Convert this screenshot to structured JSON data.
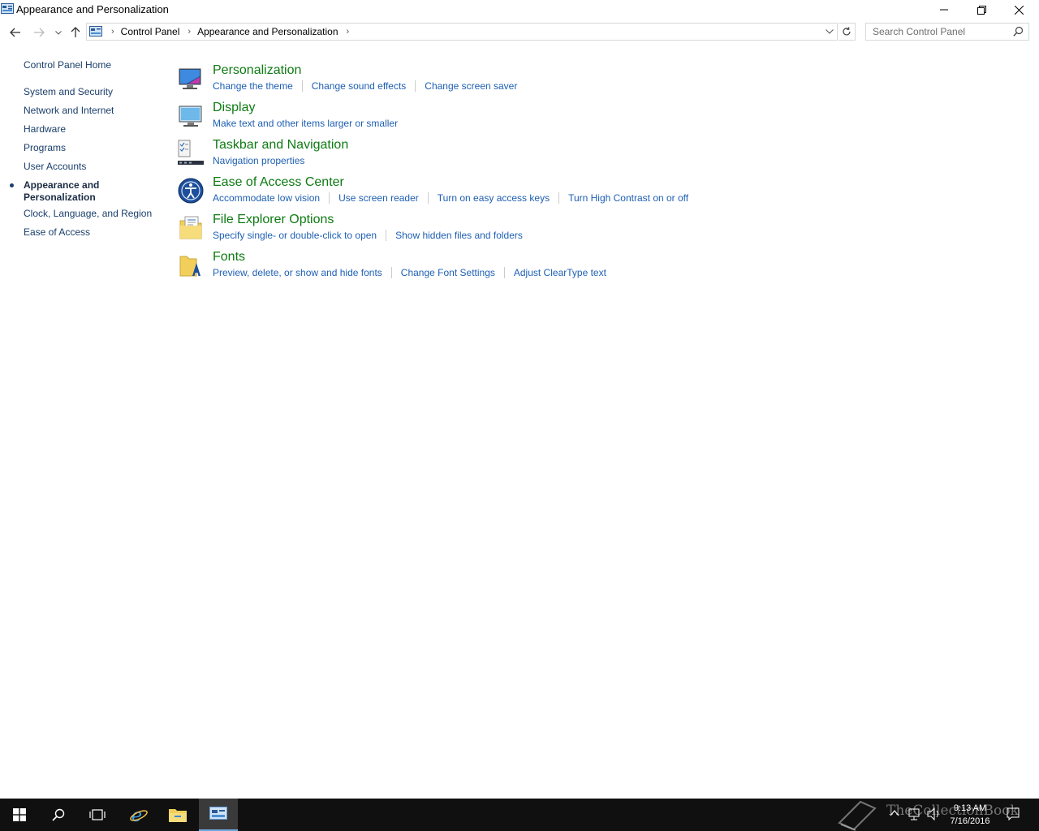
{
  "window": {
    "title": "Appearance and Personalization"
  },
  "address": {
    "crumbs": [
      "Control Panel",
      "Appearance and Personalization"
    ],
    "search_placeholder": "Search Control Panel"
  },
  "sidebar": {
    "home": "Control Panel Home",
    "items": [
      "System and Security",
      "Network and Internet",
      "Hardware",
      "Programs",
      "User Accounts"
    ],
    "active": "Appearance and Personalization",
    "items_after": [
      "Clock, Language, and Region",
      "Ease of Access"
    ]
  },
  "categories": [
    {
      "title": "Personalization",
      "icon": "personalization-icon",
      "links": [
        "Change the theme",
        "Change sound effects",
        "Change screen saver"
      ]
    },
    {
      "title": "Display",
      "icon": "display-icon",
      "links": [
        "Make text and other items larger or smaller"
      ]
    },
    {
      "title": "Taskbar and Navigation",
      "icon": "taskbar-icon",
      "links": [
        "Navigation properties"
      ]
    },
    {
      "title": "Ease of Access Center",
      "icon": "ease-of-access-icon",
      "links": [
        "Accommodate low vision",
        "Use screen reader",
        "Turn on easy access keys",
        "Turn High Contrast on or off"
      ]
    },
    {
      "title": "File Explorer Options",
      "icon": "folder-options-icon",
      "links": [
        "Specify single- or double-click to open",
        "Show hidden files and folders"
      ]
    },
    {
      "title": "Fonts",
      "icon": "fonts-icon",
      "links": [
        "Preview, delete, or show and hide fonts",
        "Change Font Settings",
        "Adjust ClearType text"
      ]
    }
  ],
  "taskbar": {
    "time": "9:13 AM",
    "date": "7/16/2016",
    "watermark": "TheCollectionBook"
  },
  "colors": {
    "category_title": "#0e7b12",
    "link": "#1e5fb3",
    "sidebar_link": "#1a3e6b",
    "taskbar": "#101010"
  }
}
